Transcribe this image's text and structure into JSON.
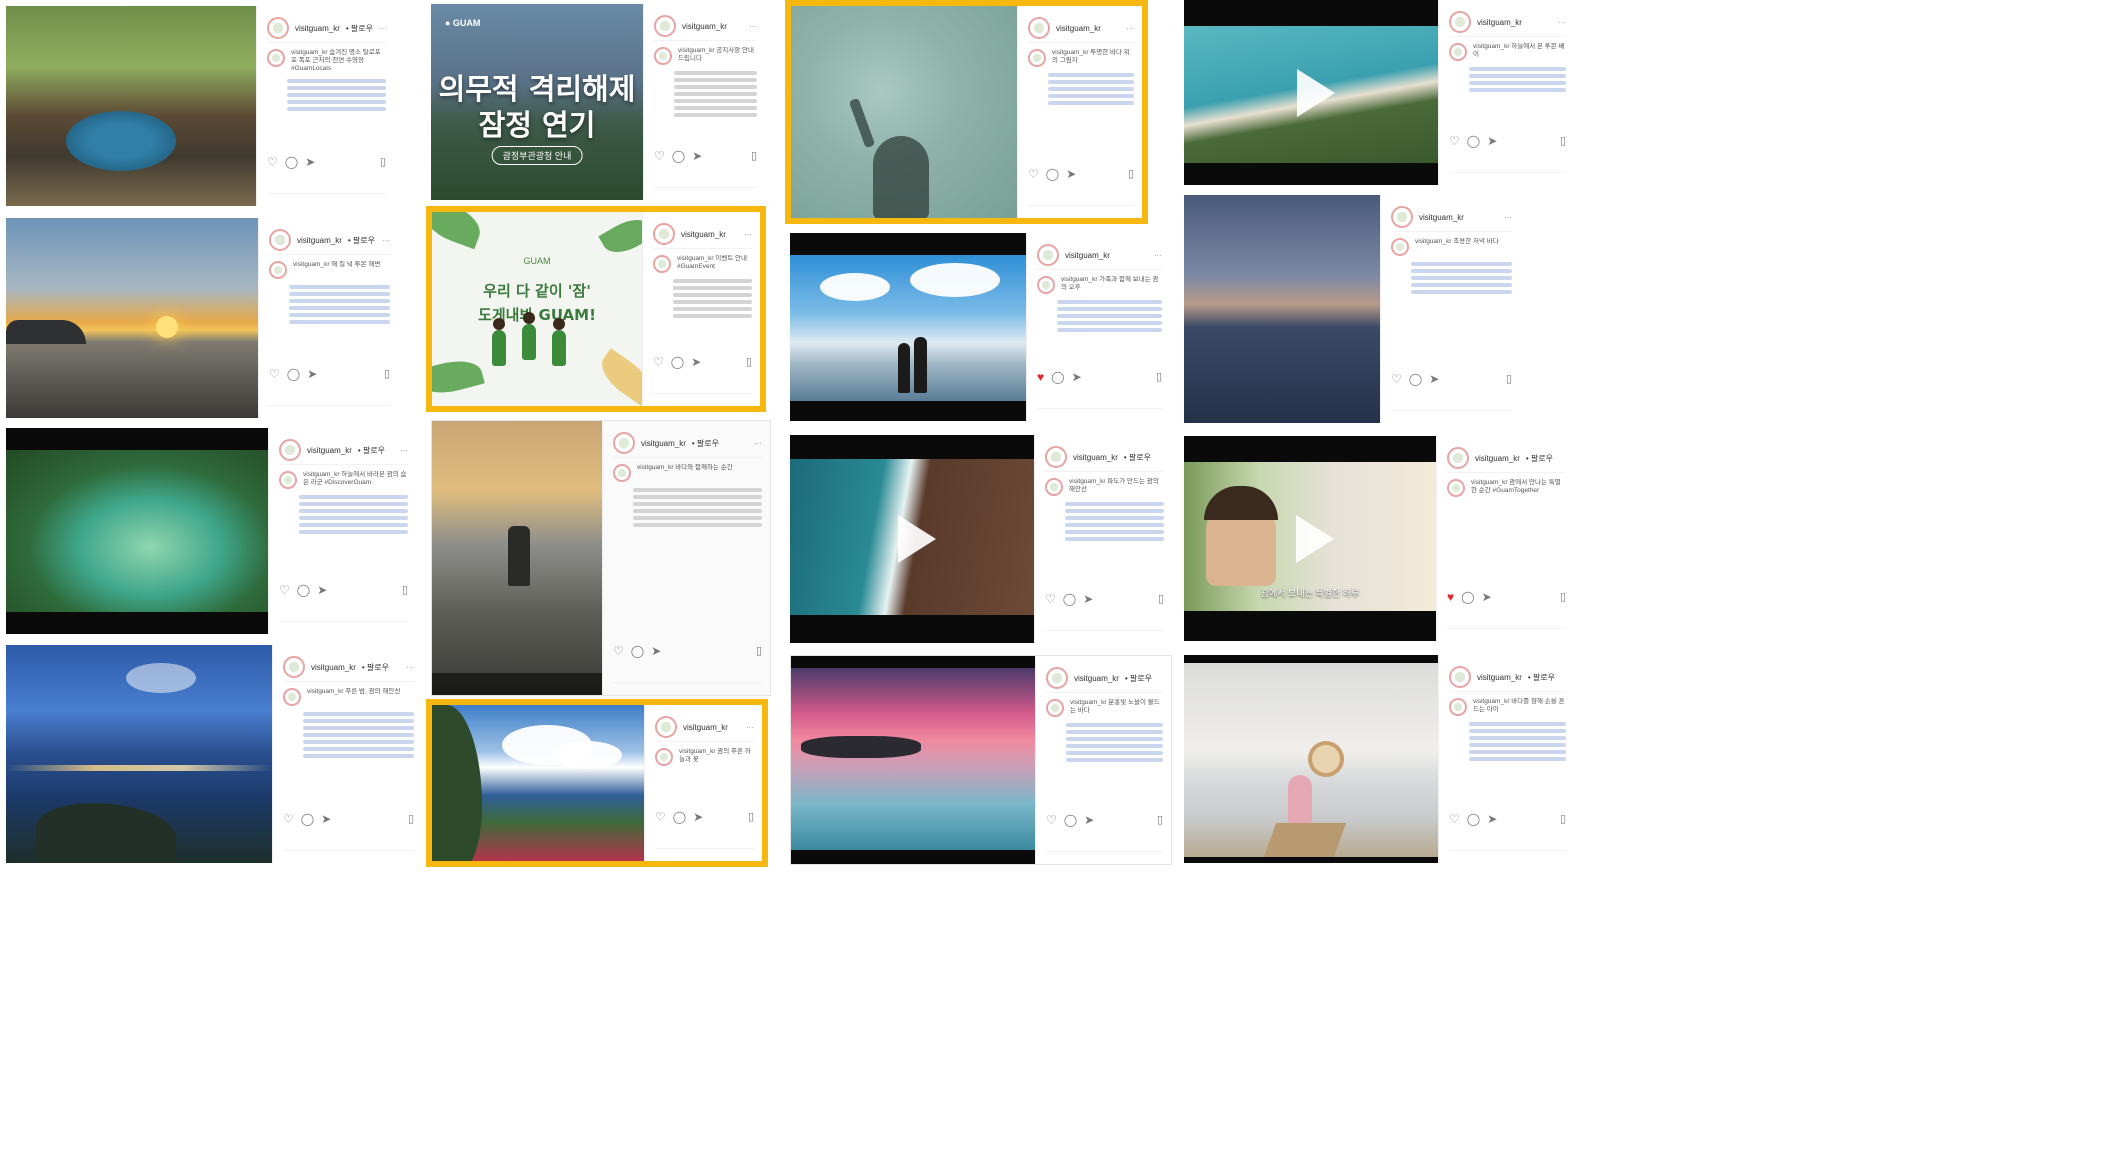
{
  "account": {
    "username": "visitguam_kr",
    "follow_label": "• 팔로우",
    "more_label": "···"
  },
  "icons": {
    "like": "heart-icon",
    "comment": "comment-icon",
    "share": "share-icon",
    "save": "bookmark-icon",
    "play": "play-icon"
  },
  "colors": {
    "highlight_border": "#f6b70e",
    "liked_heart": "#e0262f"
  },
  "posts": {
    "p1": {
      "caption": "visitguam_kr 숨겨진 명소 탈로포포 폭포 근처의 천연 수영장 #GuamLocals"
    },
    "p2": {
      "caption": "visitguam_kr 해 질 녘 투몬 해변"
    },
    "p3": {
      "caption": "visitguam_kr 하늘에서 바라본 괌의 숨은 라군 #DiscoverGuam"
    },
    "p4": {
      "caption": "visitguam_kr 푸른 밤, 괌의 해안선"
    },
    "p5": {
      "title_line1": "의무적 격리해제",
      "title_line2": "잠정 연기",
      "pill": "괌정부관광청 안내",
      "caption": "visitguam_kr 공지사항 안내드립니다"
    },
    "p6": {
      "brand": "GUAM",
      "headline_line1": "우리 다 같이 '잠'",
      "headline_line2": "도게내봐 GUAM!",
      "caption": "visitguam_kr 이벤트 안내 #GuamEvent"
    },
    "p7": {
      "caption": "visitguam_kr 바다와 함께하는 순간"
    },
    "p8": {
      "caption": "visitguam_kr 괌의 푸른 하늘과 꽃"
    },
    "p9": {
      "caption": "visitguam_kr 투명한 바다 위의 그림자"
    },
    "p10": {
      "caption": "visitguam_kr 가족과 함께 보내는 괌의 오후"
    },
    "p11": {
      "caption": "visitguam_kr 파도가 만드는 괌의 해안선"
    },
    "p12": {
      "caption": "visitguam_kr 분홍빛 노을이 물드는 바다"
    },
    "p13": {
      "caption": "visitguam_kr 하늘에서 본 투몬 베이"
    },
    "p14": {
      "caption": "visitguam_kr 조용한 저녁 바다"
    },
    "p15": {
      "subtitle": "괌에서 보내는 특별한 하루",
      "caption": "visitguam_kr 괌에서 만나는 특별한 순간 #GuamTogether"
    },
    "p16": {
      "caption": "visitguam_kr 바다를 향해 손을 흔드는 아이"
    }
  }
}
